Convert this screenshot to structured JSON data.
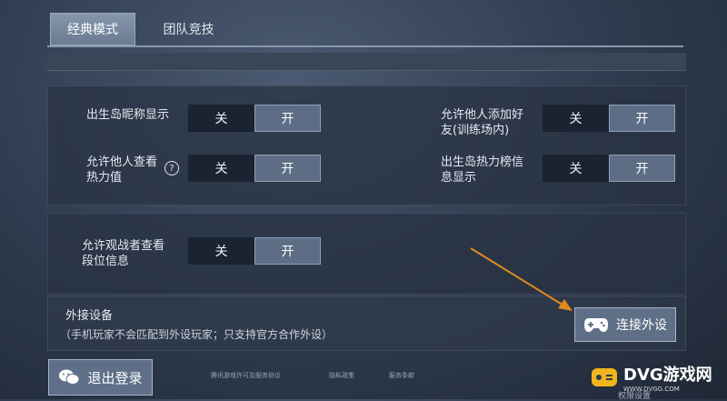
{
  "tabs": [
    {
      "label": "经典模式",
      "active": true
    },
    {
      "label": "团队竞技",
      "active": false
    }
  ],
  "settings": {
    "birth_nickname": {
      "label": "出生岛昵称显示",
      "off": "关",
      "on": "开"
    },
    "allow_friend": {
      "label": "允许他人添加好友(训练场内)",
      "off": "关",
      "on": "开"
    },
    "allow_heat": {
      "label": "允许他人查看热力值",
      "help": "?",
      "off": "关",
      "on": "开"
    },
    "heat_rank": {
      "label": "出生岛热力榜信息显示",
      "off": "关",
      "on": "开"
    },
    "spectator_rank": {
      "label": "允许观战者查看段位信息",
      "off": "关",
      "on": "开"
    }
  },
  "external": {
    "title": "外接设备",
    "note": "（手机玩家不会匹配到外设玩家；只支持官方合作外设）",
    "connect_label": "连接外设",
    "connect_icon": "gamepad-icon"
  },
  "footer": {
    "logout_label": "退出登录",
    "logout_icon": "wechat-icon",
    "links": [
      "腾讯游戏许可及服务协议",
      "隐私政策",
      "服务条款"
    ],
    "partial_label": "权限设置"
  },
  "watermark": {
    "main": "DVG游戏网",
    "sub": "WWW.DVGG.COM"
  },
  "colors": {
    "arrow": "#e08a1e",
    "toggle_on": "#5c6d85",
    "toggle_off": "#1a2330"
  }
}
